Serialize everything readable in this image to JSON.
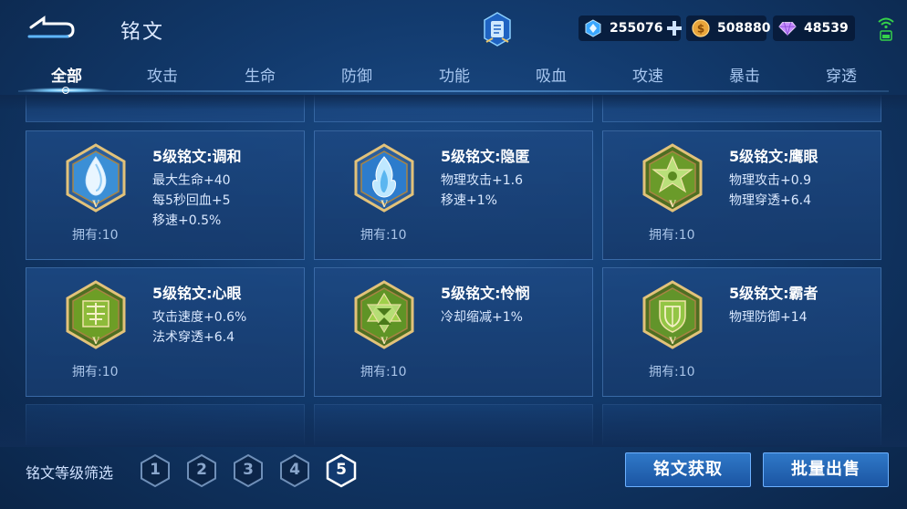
{
  "header": {
    "title": "铭文",
    "currencies": [
      {
        "icon": "diamond-coupon-icon",
        "value": "255076"
      },
      {
        "icon": "gold-coin-icon",
        "value": "508880"
      },
      {
        "icon": "purple-crystal-icon",
        "value": "48539"
      }
    ]
  },
  "tabs": [
    {
      "label": "全部",
      "active": true
    },
    {
      "label": "攻击"
    },
    {
      "label": "生命"
    },
    {
      "label": "防御"
    },
    {
      "label": "功能"
    },
    {
      "label": "吸血"
    },
    {
      "label": "攻速"
    },
    {
      "label": "暴击"
    },
    {
      "label": "穿透"
    }
  ],
  "cards": [
    {
      "name": "5级铭文:调和",
      "attrs": [
        "最大生命+40",
        "每5秒回血+5",
        "移速+0.5%"
      ],
      "owned": "拥有:10",
      "icon": "water-drop-emblem-icon",
      "color": "#3b8fd6"
    },
    {
      "name": "5级铭文:隐匿",
      "attrs": [
        "物理攻击+1.6",
        "移速+1%"
      ],
      "owned": "拥有:10",
      "icon": "blue-flame-emblem-icon",
      "color": "#2d7ccc"
    },
    {
      "name": "5级铭文:鹰眼",
      "attrs": [
        "物理攻击+0.9",
        "物理穿透+6.4"
      ],
      "owned": "拥有:10",
      "icon": "green-star-emblem-icon",
      "color": "#6a9b2a"
    },
    {
      "name": "5级铭文:心眼",
      "attrs": [
        "攻击速度+0.6%",
        "法术穿透+6.4"
      ],
      "owned": "拥有:10",
      "icon": "green-rune-emblem-icon",
      "color": "#6d9e26"
    },
    {
      "name": "5级铭文:怜悯",
      "attrs": [
        "冷却缩减+1%"
      ],
      "owned": "拥有:10",
      "icon": "hourglass-emblem-icon",
      "color": "#5f9426"
    },
    {
      "name": "5级铭文:霸者",
      "attrs": [
        "物理防御+14"
      ],
      "owned": "拥有:10",
      "icon": "green-shield-emblem-icon",
      "color": "#62942a"
    }
  ],
  "bottom": {
    "filter_label": "铭文等级筛选",
    "levels": [
      "1",
      "2",
      "3",
      "4",
      "5"
    ],
    "active_level": "5",
    "obtain_button": "铭文获取",
    "bulk_sell_button": "批量出售"
  }
}
